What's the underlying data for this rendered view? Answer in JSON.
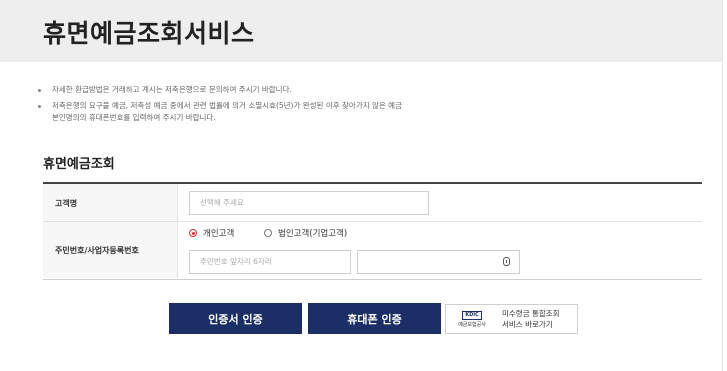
{
  "header": {
    "title": "휴면예금조회서비스"
  },
  "notices": [
    "자세한 환급방법은 거래하고 계시는 저축은행으로 문의하여 주시기 바랍니다.",
    "저축은행의 요구불 예금, 저축성 예금 중에서 관련 법률에 의거 소멸시효(5년)가 완성된 이후 찾아가지 않은 예금",
    "본인명의의 휴대폰번호를 입력하여 주시기 바랍니다."
  ],
  "section": {
    "title": "휴면예금조회"
  },
  "form": {
    "customer_name_label": "고객명",
    "customer_name_placeholder": "선택해 주세요",
    "id_number_label": "주민번호/사업자등록번호",
    "radio_personal": "개인고객",
    "radio_corporate": "법인고객(기업고객)",
    "selected_type": "개인고객",
    "rrn_front_placeholder": "주민번호 앞자리 6자리",
    "rrn_back_value": ""
  },
  "buttons": {
    "certificate": "인증서 인증",
    "phone": "휴대폰 인증",
    "unclaimed_line1": "미수령금 통합조회",
    "unclaimed_line2": "서비스 바로가기",
    "kdic_mark": "KDIC",
    "kdic_name": "예금보험공사"
  },
  "colors": {
    "header_bg": "#eeeeee",
    "button_navy": "#1b2f66",
    "radio_accent": "#d0312d"
  },
  "icons": {
    "secure_field": "lock-icon"
  }
}
